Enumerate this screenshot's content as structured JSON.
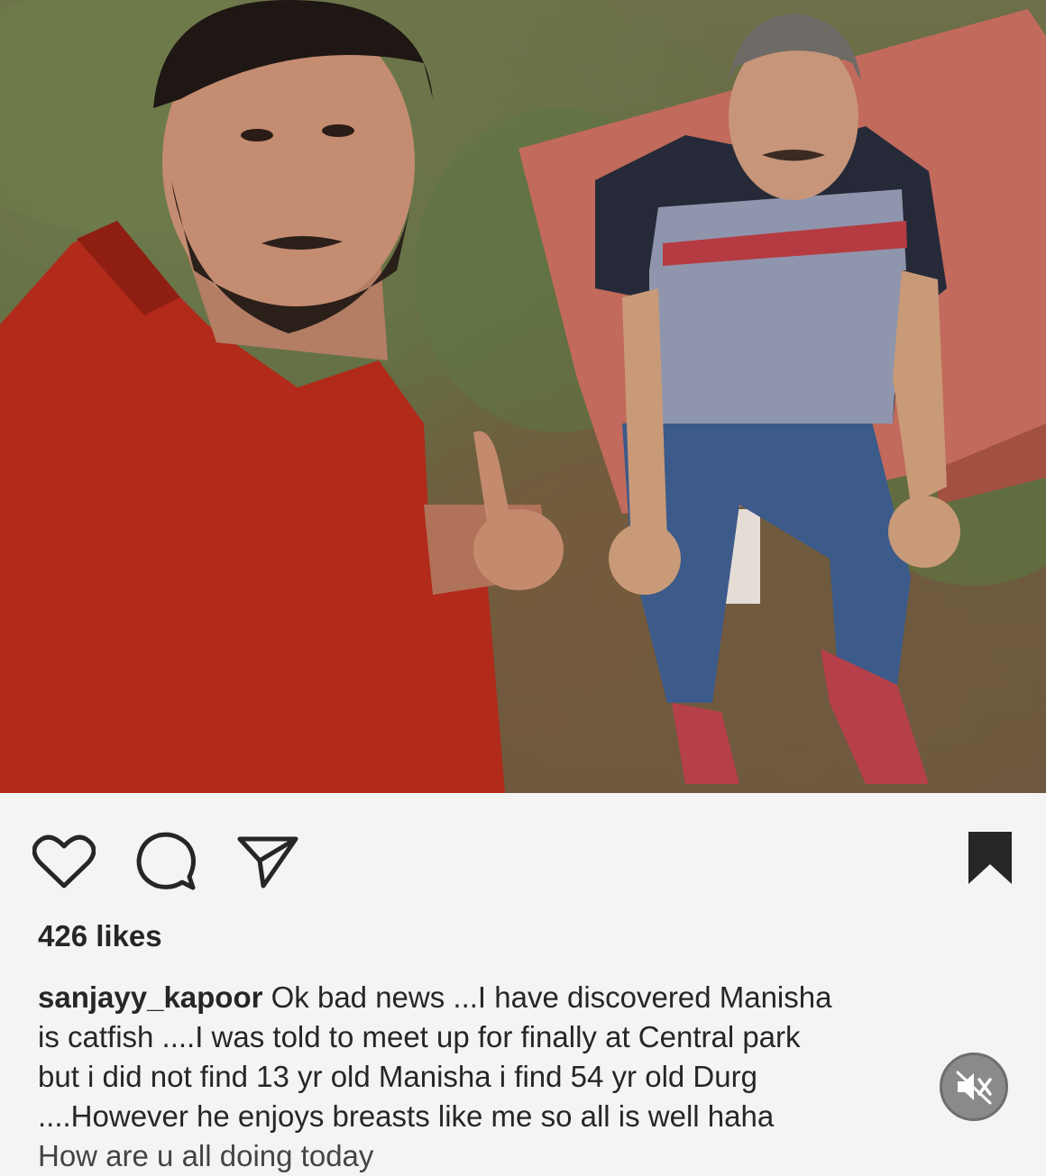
{
  "post": {
    "photo_alt_icon": "post-photo",
    "actions": {
      "like_icon": "heart-icon",
      "comment_icon": "comment-icon",
      "share_icon": "send-icon",
      "save_icon": "bookmark-icon"
    },
    "likes_text": "426 likes",
    "caption": {
      "username": "sanjayy_kapoor",
      "lines": [
        "Ok bad news ...I have discovered Manisha",
        "is catfish ....I was told to meet up for finally at Central park",
        "but i did not find 13 yr old Manisha i find 54 yr old Durg",
        "....However he enjoys breasts like me so all is well haha"
      ],
      "truncated_line": "How are u all doing today"
    },
    "mute_icon": "speaker-muted-icon"
  },
  "colors": {
    "background": "#f4f4f4",
    "text": "#262626",
    "mute_badge": "#8a8a8a"
  }
}
